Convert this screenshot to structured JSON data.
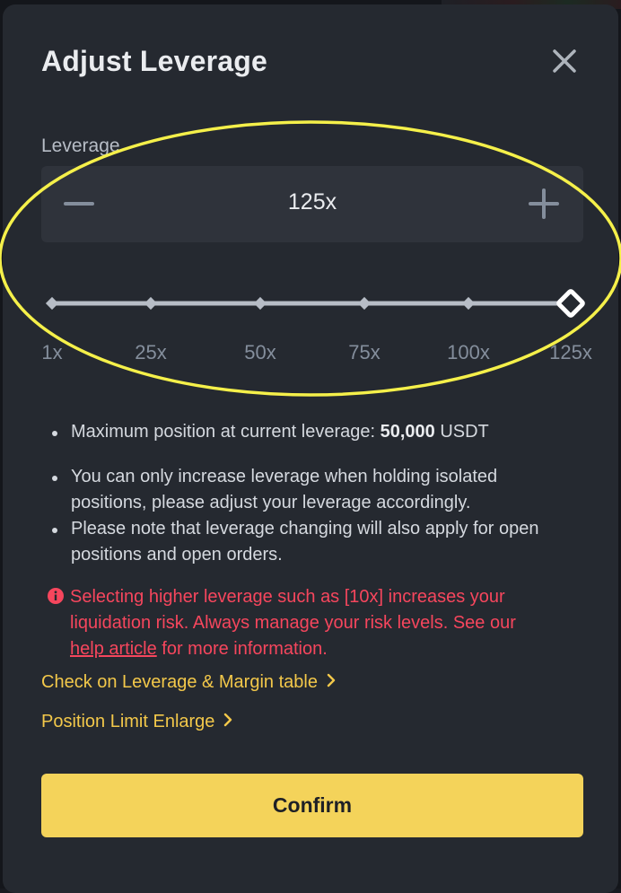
{
  "dialog": {
    "title": "Adjust Leverage",
    "close_icon": "close-icon"
  },
  "leverage": {
    "label": "Leverage",
    "value": "125x",
    "minus_icon": "minus-icon",
    "plus_icon": "plus-icon"
  },
  "slider": {
    "marks": [
      "1x",
      "25x",
      "50x",
      "75x",
      "100x",
      "125x"
    ],
    "selected_index": 5,
    "selected_value": 125,
    "min": 1,
    "max": 125,
    "colors": {
      "track": "#b7bdc6",
      "handle_fill": "#252930",
      "handle_border": "#ffffff"
    }
  },
  "info": {
    "bullet1_prefix": "Maximum position at current leverage: ",
    "bullet1_amount": "50,000",
    "bullet1_unit": " USDT",
    "bullet2_line1": "You can only increase leverage when holding isolated",
    "bullet2_line2": "positions, please adjust your leverage accordingly.",
    "bullet3_line1": "Please note that leverage changing will also apply for open",
    "bullet3_line2": "positions and open orders."
  },
  "warning": {
    "icon": "info-circle-icon",
    "line1": "Selecting higher leverage such as [10x] increases your",
    "line2": "liquidation risk. Always manage your risk levels. See our",
    "link_text": "help article",
    "line3_suffix": " for more information.",
    "color": "#f6465d"
  },
  "links": {
    "margin_table": "Check on Leverage & Margin table",
    "position_limit": "Position Limit Enlarge",
    "color": "#f3c84a"
  },
  "confirm": {
    "label": "Confirm",
    "color": "#f4d35a"
  },
  "annotation": {
    "highlight_color": "#f5f04a"
  }
}
